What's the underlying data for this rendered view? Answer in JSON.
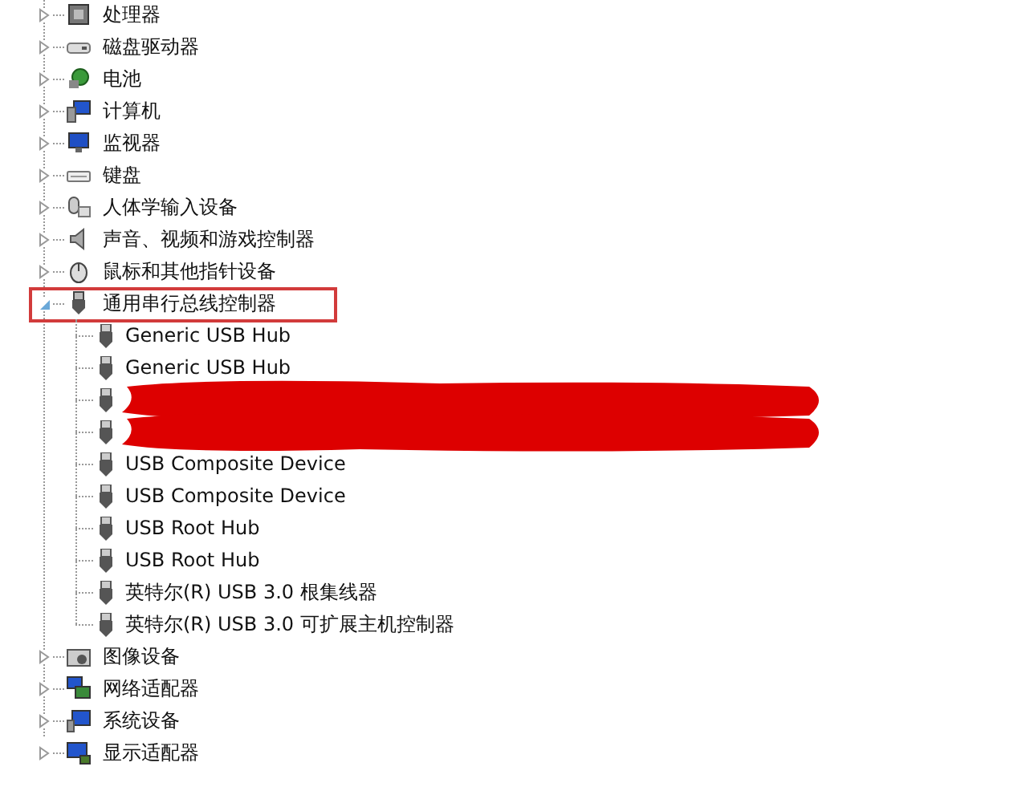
{
  "tree": [
    {
      "label": "处理器",
      "kind": "processor",
      "expanded": false,
      "annotated": false
    },
    {
      "label": "磁盘驱动器",
      "kind": "disk",
      "expanded": false,
      "annotated": false
    },
    {
      "label": "电池",
      "kind": "battery",
      "expanded": false,
      "annotated": false
    },
    {
      "label": "计算机",
      "kind": "computer",
      "expanded": false,
      "annotated": false
    },
    {
      "label": "监视器",
      "kind": "monitor",
      "expanded": false,
      "annotated": false
    },
    {
      "label": "键盘",
      "kind": "keyboard",
      "expanded": false,
      "annotated": false
    },
    {
      "label": "人体学输入设备",
      "kind": "hid",
      "expanded": false,
      "annotated": false
    },
    {
      "label": "声音、视频和游戏控制器",
      "kind": "sound",
      "expanded": false,
      "annotated": false
    },
    {
      "label": "鼠标和其他指针设备",
      "kind": "mouse",
      "expanded": false,
      "annotated": false
    },
    {
      "label": "通用串行总线控制器",
      "kind": "usb",
      "expanded": true,
      "annotated": true,
      "children": [
        {
          "kind": "device",
          "label": "Generic USB Hub"
        },
        {
          "kind": "device",
          "label": "Generic USB Hub"
        },
        {
          "kind": "redacted"
        },
        {
          "kind": "redacted"
        },
        {
          "kind": "device",
          "label": "USB Composite Device"
        },
        {
          "kind": "device",
          "label": "USB Composite Device"
        },
        {
          "kind": "device",
          "label": "USB Root Hub"
        },
        {
          "kind": "device",
          "label": "USB Root Hub"
        },
        {
          "kind": "device",
          "label": "英特尔(R) USB 3.0 根集线器"
        },
        {
          "kind": "device",
          "label": "英特尔(R) USB 3.0 可扩展主机控制器"
        }
      ]
    },
    {
      "label": "图像设备",
      "kind": "camera",
      "expanded": false,
      "annotated": false
    },
    {
      "label": "网络适配器",
      "kind": "network",
      "expanded": false,
      "annotated": false
    },
    {
      "label": "系统设备",
      "kind": "system",
      "expanded": false,
      "annotated": false
    },
    {
      "label": "显示适配器",
      "kind": "display",
      "expanded": false,
      "annotated": false
    }
  ]
}
